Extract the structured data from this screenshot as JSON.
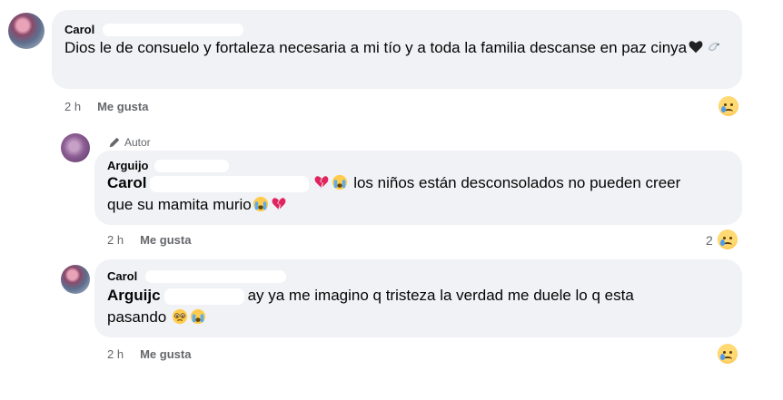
{
  "comments": [
    {
      "author": "Carol",
      "text": "Dios le de consuelo y fortaleza necesaria a mi tío y a toda la familia descanse en paz cinya",
      "time": "2 h",
      "like_label": "Me gusta",
      "reaction_icon": "crying-face-icon"
    },
    {
      "badge": "Autor",
      "author": "Arguijo",
      "mention": "Carol",
      "text_before": "los niños están desconsolados no pueden creer",
      "text_after": "que su mamita murio",
      "time": "2 h",
      "like_label": "Me gusta",
      "reaction_count": "2",
      "reaction_icon": "crying-face-icon"
    },
    {
      "author": "Carol",
      "mention": "Arguijc",
      "text_before": "ay ya me imagino q tristeza la verdad me duele lo q esta",
      "text_after": "pasando",
      "time": "2 h",
      "like_label": "Me gusta",
      "reaction_icon": "crying-face-icon"
    }
  ],
  "colors": {
    "bubble": "#f0f2f5",
    "meta": "#65676b",
    "text": "#050505"
  }
}
